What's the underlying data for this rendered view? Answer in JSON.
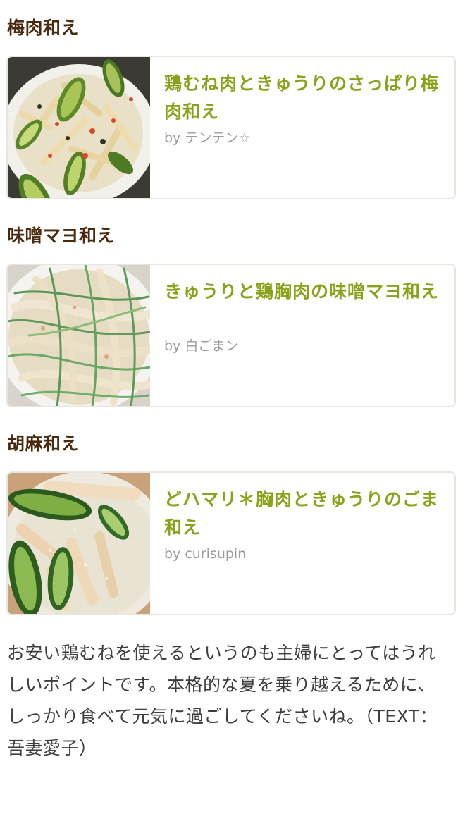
{
  "sections": [
    {
      "heading": "梅肉和え",
      "recipe": {
        "title": "鶏むね肉ときゅうりのさっぱり梅肉和え",
        "author": "by テンテン☆"
      }
    },
    {
      "heading": "味噌マヨ和え",
      "recipe": {
        "title": "きゅうりと鶏胸肉の味噌マヨ和え",
        "author": "by 白ごまン"
      }
    },
    {
      "heading": "胡麻和え",
      "recipe": {
        "title": "どハマリ＊胸肉ときゅうりのごま和え",
        "author": "by curisupin"
      }
    }
  ],
  "article": {
    "body": "お安い鶏むねを使えるというのも主婦にとってはうれしいポイントです。本格的な夏を乗り越えるために、しっかり食べて元気に過ごしてくださいね。（TEXT：吾妻愛子）"
  }
}
